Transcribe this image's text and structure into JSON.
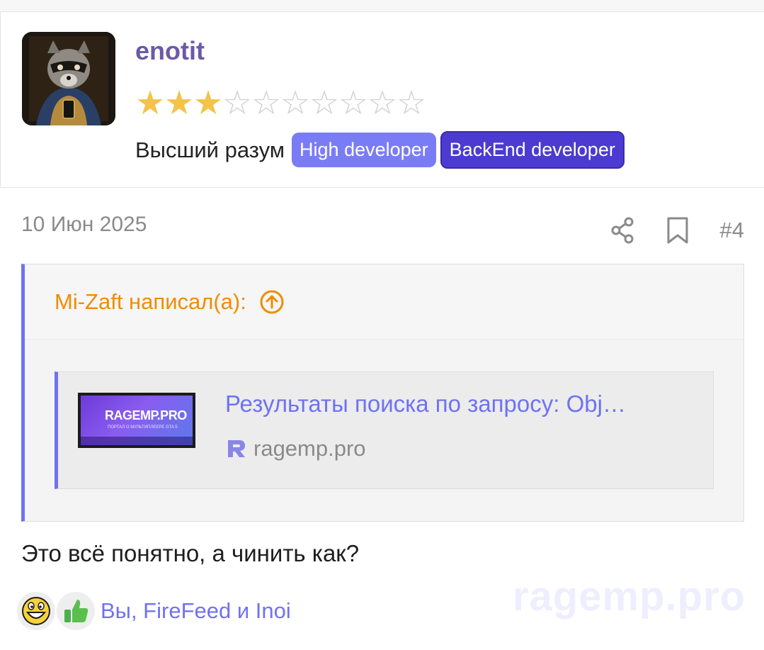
{
  "user": {
    "name": "enotit",
    "rating": 3,
    "rating_max": 10,
    "title": "Высший разум",
    "badges": [
      "High developer",
      "BackEnd developer"
    ]
  },
  "post": {
    "date": "10 Июн 2025",
    "number": "#4",
    "text": "Это всё понятно, а чинить как?"
  },
  "quote": {
    "author": "Mi-Zaft написал(а):",
    "embed": {
      "title": "Результаты поиска по запросу: Obj…",
      "domain": "ragemp.pro",
      "thumb_logo": "RAGEMP.PRO",
      "thumb_sub": "ПОРТАЛ О МУЛЬТИПЛЕЕРЕ GTA 5"
    }
  },
  "reactions": {
    "icons": [
      "laugh-emoji-icon",
      "thumbs-up-icon"
    ],
    "users": "Вы, FireFeed и Inoi"
  },
  "watermark": "ragemp.pro",
  "colors": {
    "accent": "#6f72f2",
    "username": "#6b5aa8",
    "quote_author": "#f08c00",
    "badge_high": "#7a7cf5",
    "badge_backend": "#4b3bd0",
    "star": "#f3c34a"
  }
}
